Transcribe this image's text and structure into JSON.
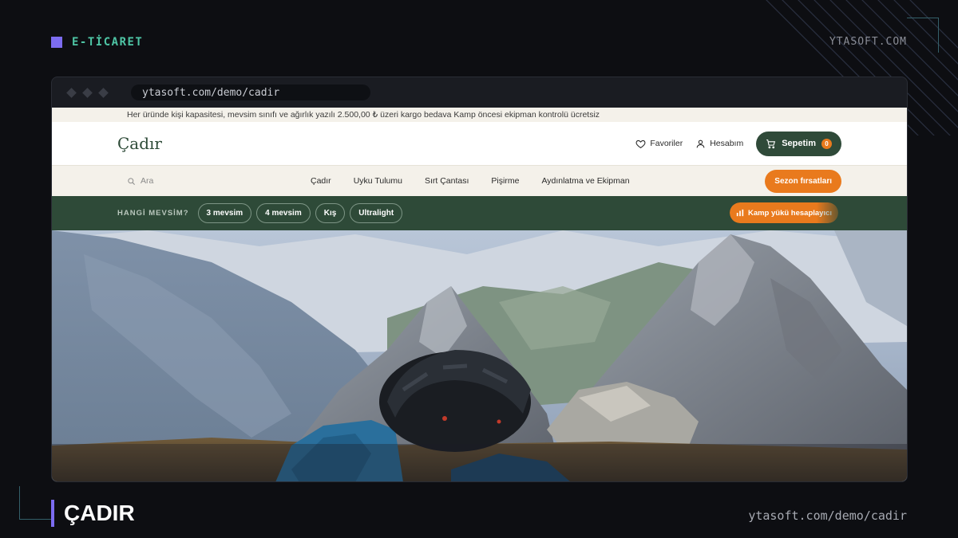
{
  "frame": {
    "tag": "E-TİCARET",
    "brand": "YTASOFT.COM",
    "title": "ÇADIR",
    "url_footer": "ytasoft.com/demo/cadir"
  },
  "browser": {
    "url": "ytasoft.com/demo/cadir"
  },
  "announce": {
    "text": "Her üründe kişi kapasitesi, mevsim sınıfı ve ağırlık yazılı 2.500,00 ₺ üzeri kargo bedava Kamp öncesi ekipman kontrolü ücretsiz"
  },
  "header": {
    "logo": "Çadır",
    "favorites": "Favoriler",
    "account": "Hesabım",
    "cart": "Sepetim",
    "cart_count": "0"
  },
  "nav": {
    "search_placeholder": "Ara",
    "items": [
      "Çadır",
      "Uyku Tulumu",
      "Sırt Çantası",
      "Pişirme",
      "Aydınlatma ve Ekipman"
    ],
    "promo": "Sezon fırsatları"
  },
  "season": {
    "question": "HANGİ MEVSİM?",
    "chips": [
      "3 mevsim",
      "4 mevsim",
      "Kış",
      "Ultralight"
    ],
    "calculator": "Kamp yükü hesaplayıcı"
  },
  "icons": {
    "heart": "heart-icon",
    "user": "user-icon",
    "cart": "cart-icon",
    "search": "search-icon",
    "chart": "bar-chart-icon"
  },
  "colors": {
    "accent_purple": "#7c6cf0",
    "tag_green": "#4ec5a5",
    "forest": "#2e4a38",
    "orange": "#e97a1d",
    "cream": "#f4f1ea"
  }
}
